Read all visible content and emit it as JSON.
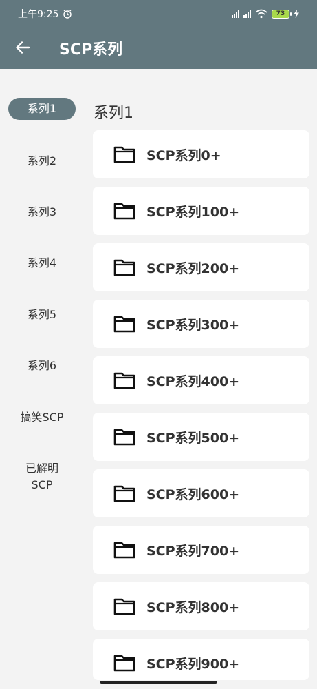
{
  "status": {
    "time": "上午9:25",
    "battery": "73"
  },
  "toolbar": {
    "title": "SCP系列"
  },
  "sidebar": {
    "items": [
      {
        "label": "系列1",
        "active": true
      },
      {
        "label": "系列2"
      },
      {
        "label": "系列3"
      },
      {
        "label": "系列4"
      },
      {
        "label": "系列5"
      },
      {
        "label": "系列6"
      },
      {
        "label": "搞笑SCP"
      },
      {
        "label": "已解明\nSCP"
      }
    ]
  },
  "main": {
    "section_title": "系列1",
    "cards": [
      {
        "label": "SCP系列0+"
      },
      {
        "label": "SCP系列100+"
      },
      {
        "label": "SCP系列200+"
      },
      {
        "label": "SCP系列300+"
      },
      {
        "label": "SCP系列400+"
      },
      {
        "label": "SCP系列500+"
      },
      {
        "label": "SCP系列600+"
      },
      {
        "label": "SCP系列700+"
      },
      {
        "label": "SCP系列800+"
      },
      {
        "label": "SCP系列900+"
      }
    ]
  },
  "colors": {
    "appbar": "#62787f",
    "background": "#f3f3f3",
    "card": "#ffffff"
  }
}
